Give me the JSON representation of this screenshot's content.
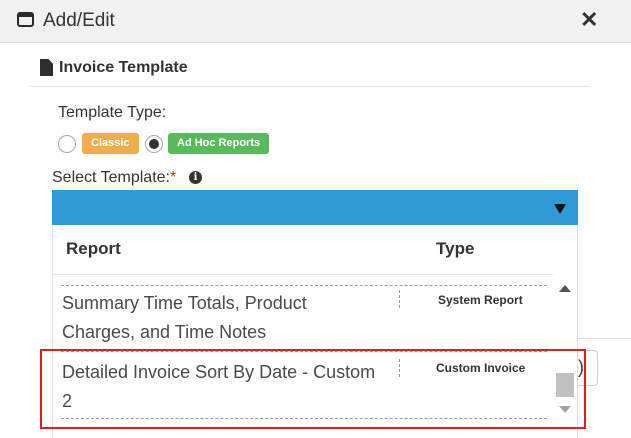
{
  "window": {
    "title": "Add/Edit",
    "icon": "window-icon",
    "close_icon": "close-icon",
    "close_glyph": "✕"
  },
  "section": {
    "title": "Invoice Template",
    "icon": "file-icon"
  },
  "template_type": {
    "label": "Template Type:",
    "options": [
      {
        "label": "Classic",
        "selected": false,
        "color": "#f0ad4e"
      },
      {
        "label": "Ad Hoc Reports",
        "selected": true,
        "color": "#5cb85c"
      }
    ]
  },
  "select_template": {
    "label": "Select Template:",
    "required_mark": "*",
    "info_icon": "info-icon",
    "info_glyph": "i",
    "bar_color": "#2f9ad6"
  },
  "dropdown": {
    "columns": [
      "Report",
      "Type"
    ],
    "rows": [
      {
        "name": "Summary Time Totals, Product Charges, and Time Notes",
        "type": "System Report"
      },
      {
        "name": "Detailed Invoice Sort By Date - Custom 2",
        "type": "Custom Invoice"
      }
    ]
  },
  "background_fragment": ")",
  "highlight_color": "#e02020"
}
